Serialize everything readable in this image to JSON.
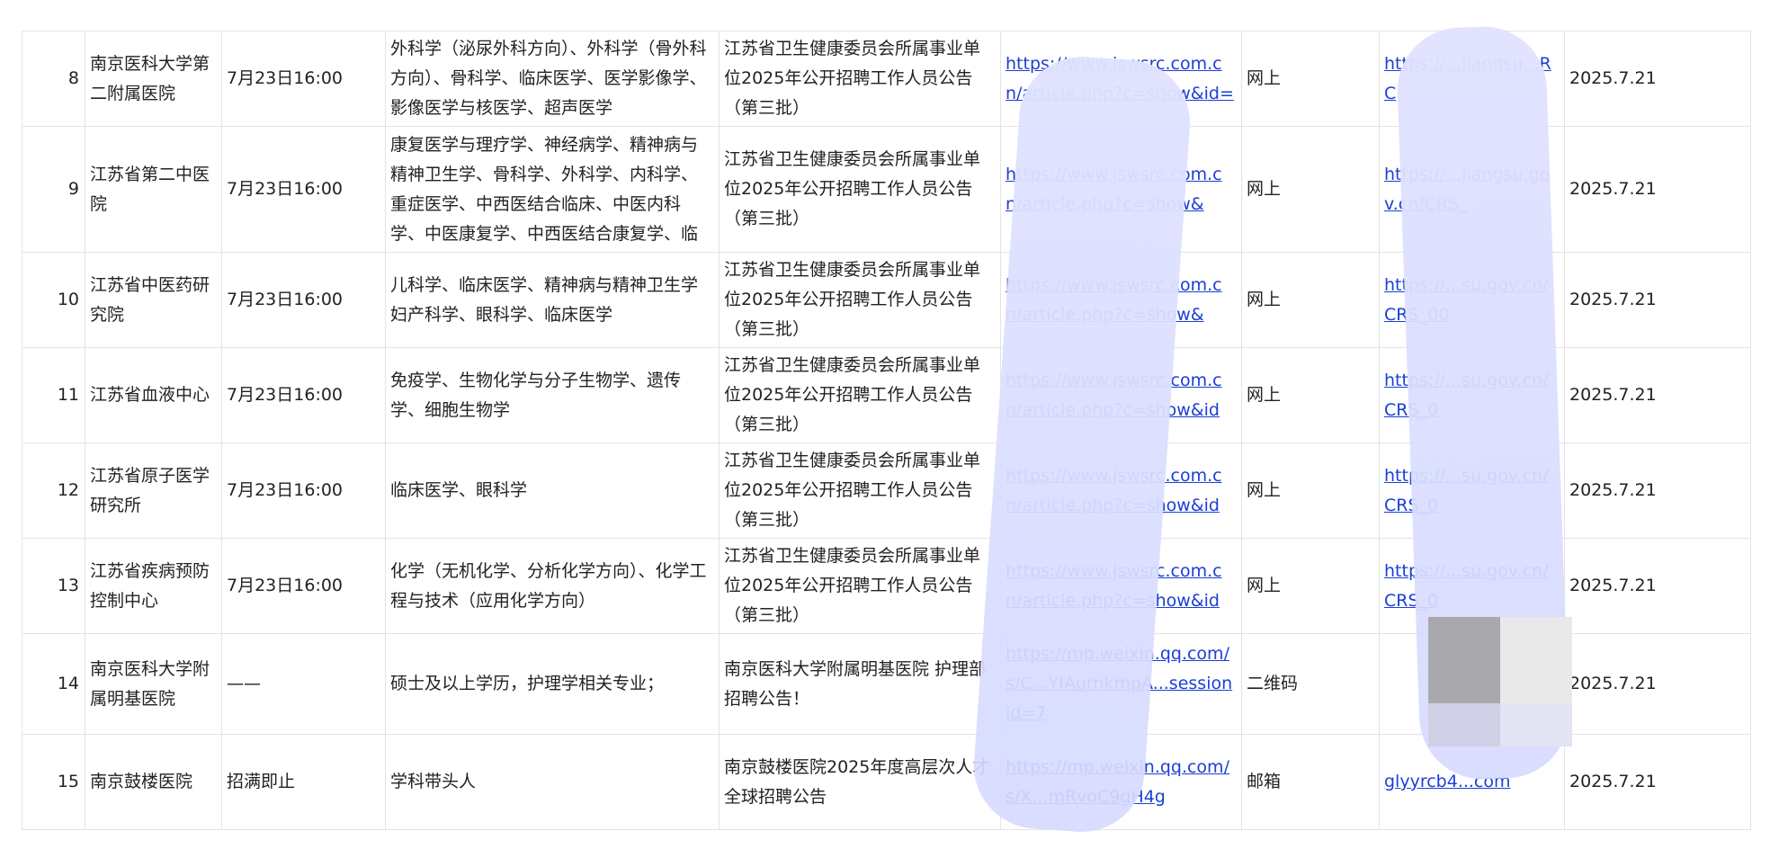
{
  "rows": [
    {
      "no": "8",
      "unit": "南京医科大学第二附属医院",
      "deadline": "7月23日16:00",
      "majors": "外科学（泌尿外科方向）、外科学（骨外科方向）、骨科学、临床医学、医学影像学、影像医学与核医学、超声医学",
      "notice": "江苏省卫生健康委员会所属事业单位2025年公开招聘工作人员公告（第三批）",
      "link": "https://www.jswsrc.com.cn/article.php?c=show&id=",
      "method": "网上",
      "apply_link": "https://...jiangsu...RC",
      "date": "2025.7.21"
    },
    {
      "no": "9",
      "unit": "江苏省第二中医院",
      "deadline": "7月23日16:00",
      "majors": "康复医学与理疗学、神经病学、精神病与精神卫生学、骨科学、外科学、内科学、重症医学、中西医结合临床、中医内科学、中医康复学、中西医结合康复学、临床",
      "notice": "江苏省卫生健康委员会所属事业单位2025年公开招聘工作人员公告（第三批）",
      "link": "https://www.jswsrc.com.cn/article.php?c=show&",
      "method": "网上",
      "apply_link": "https://...jiangsu.gov.cn/CRS_",
      "date": "2025.7.21"
    },
    {
      "no": "10",
      "unit": "江苏省中医药研究院",
      "deadline": "7月23日16:00",
      "majors": "儿科学、临床医学、精神病与精神卫生学妇产科学、眼科学、临床医学",
      "notice": "江苏省卫生健康委员会所属事业单位2025年公开招聘工作人员公告（第三批）",
      "link": "https://www.jswsrc.com.cn/article.php?c=show&",
      "method": "网上",
      "apply_link": "https://...su.gov.cn/CRS_00",
      "date": "2025.7.21"
    },
    {
      "no": "11",
      "unit": "江苏省血液中心",
      "deadline": "7月23日16:00",
      "majors": "免疫学、生物化学与分子生物学、遗传学、细胞生物学",
      "notice": "江苏省卫生健康委员会所属事业单位2025年公开招聘工作人员公告（第三批）",
      "link": "https://www.jswsrc.com.cn/article.php?c=show&id",
      "method": "网上",
      "apply_link": "https://...su.gov.cn/CRS_0",
      "date": "2025.7.21"
    },
    {
      "no": "12",
      "unit": "江苏省原子医学研究所",
      "deadline": "7月23日16:00",
      "majors": "临床医学、眼科学",
      "notice": "江苏省卫生健康委员会所属事业单位2025年公开招聘工作人员公告（第三批）",
      "link": "https://www.jswsrc.com.cn/article.php?c=show&id",
      "method": "网上",
      "apply_link": "https://...su.gov.cn/CRS_0",
      "date": "2025.7.21"
    },
    {
      "no": "13",
      "unit": "江苏省疾病预防控制中心",
      "deadline": "7月23日16:00",
      "majors": "化学（无机化学、分析化学方向）、化学工程与技术（应用化学方向）",
      "notice": "江苏省卫生健康委员会所属事业单位2025年公开招聘工作人员公告（第三批）",
      "link": "https://www.jswsrc.com.cn/article.php?c=show&id",
      "method": "网上",
      "apply_link": "https://...su.gov.cn/CRS_0",
      "date": "2025.7.21"
    },
    {
      "no": "14",
      "unit": "南京医科大学附属明基医院",
      "deadline": "——",
      "majors": "硕士及以上学历，护理学相关专业；",
      "notice": "南京医科大学附属明基医院 护理部招聘公告！",
      "link": "https://mp.weixin.qq.com/s/C...YIAurnkmpA...sessionid=7",
      "method": "二维码",
      "apply_link": "",
      "date": "2025.7.21"
    },
    {
      "no": "15",
      "unit": "南京鼓楼医院",
      "deadline": "招满即止",
      "majors": "学科带头人",
      "notice": "南京鼓楼医院2025年度高层次人才全球招聘公告",
      "link": "https://mp.weixin.qq.com/s/X...mRvoC9gH4g",
      "method": "邮箱",
      "apply_link": "glyyrcb4...com",
      "date": "2025.7.21"
    }
  ]
}
